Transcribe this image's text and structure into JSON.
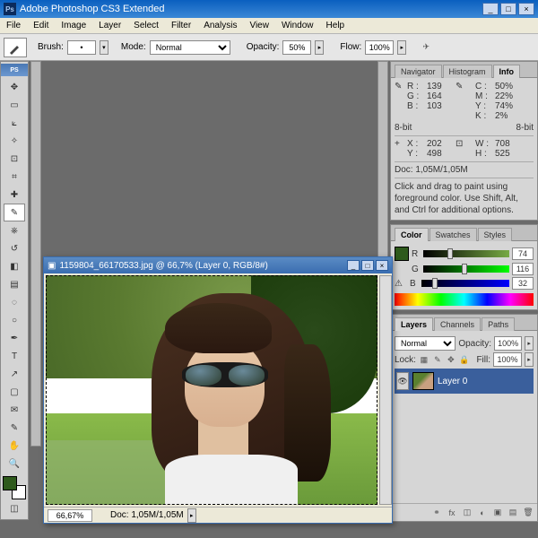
{
  "title": "Adobe Photoshop CS3 Extended",
  "menu": [
    "File",
    "Edit",
    "Image",
    "Layer",
    "Select",
    "Filter",
    "Analysis",
    "View",
    "Window",
    "Help"
  ],
  "options": {
    "brush_label": "Brush:",
    "mode_label": "Mode:",
    "mode_value": "Normal",
    "opacity_label": "Opacity:",
    "opacity_value": "50%",
    "flow_label": "Flow:",
    "flow_value": "100%"
  },
  "toolbox_header": "PS",
  "info_panel": {
    "tabs": [
      "Navigator",
      "Histogram",
      "Info"
    ],
    "R": "139",
    "G": "164",
    "B": "103",
    "C": "50%",
    "M": "22%",
    "Y": "74%",
    "K": "2%",
    "bits_left": "8-bit",
    "bits_right": "8-bit",
    "X": "202",
    "Yv": "498",
    "W": "708",
    "H": "525",
    "doc_label": "Doc:",
    "doc_value": "1,05M/1,05M",
    "hint": "Click and drag to paint using foreground color. Use Shift, Alt, and Ctrl for additional options."
  },
  "color_panel": {
    "tabs": [
      "Color",
      "Swatches",
      "Styles"
    ],
    "R": "74",
    "G": "116",
    "B": "32"
  },
  "layers_panel": {
    "tabs": [
      "Layers",
      "Channels",
      "Paths"
    ],
    "mode": "Normal",
    "opacity_label": "Opacity:",
    "opacity": "100%",
    "lock_label": "Lock:",
    "fill_label": "Fill:",
    "fill": "100%",
    "layer_name": "Layer 0"
  },
  "document": {
    "title": "1159804_66170533.jpg @ 66,7% (Layer 0, RGB/8#)",
    "zoom": "66,67%",
    "doc_info": "Doc: 1,05M/1,05M"
  },
  "chart_data": null
}
